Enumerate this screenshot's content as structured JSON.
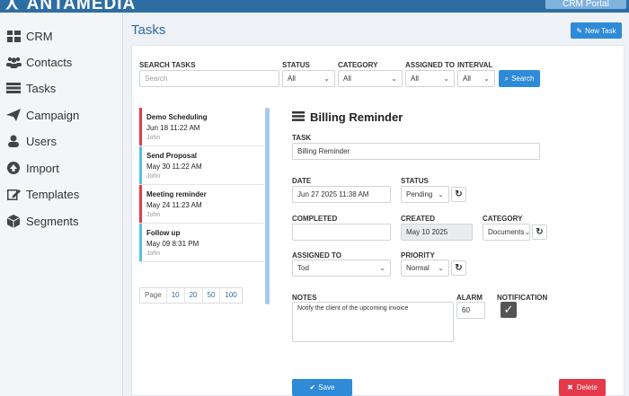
{
  "header": {
    "brand": "ANTAMEDIA",
    "portal_button": "CRM Portal"
  },
  "sidebar": {
    "items": [
      {
        "label": "CRM",
        "icon": "grid-icon"
      },
      {
        "label": "Contacts",
        "icon": "users-group-icon"
      },
      {
        "label": "Tasks",
        "icon": "list-icon"
      },
      {
        "label": "Campaign",
        "icon": "paper-plane-icon"
      },
      {
        "label": "Users",
        "icon": "user-icon"
      },
      {
        "label": "Import",
        "icon": "upload-circle-icon"
      },
      {
        "label": "Templates",
        "icon": "edit-icon"
      },
      {
        "label": "Segments",
        "icon": "cube-icon"
      }
    ]
  },
  "page": {
    "title": "Tasks",
    "new_task_button": "New Task"
  },
  "filters": {
    "search_label": "SEARCH TASKS",
    "search_placeholder": "Search",
    "status_label": "STATUS",
    "status_value": "All",
    "category_label": "CATEGORY",
    "category_value": "All",
    "assigned_label": "ASSIGNED TO",
    "assigned_value": "All",
    "interval_label": "INTERVAL",
    "interval_value": "All",
    "search_button": "Search"
  },
  "tasks": [
    {
      "title": "Demo Scheduling",
      "date": "Jun 18 11:22 AM",
      "user": "John",
      "color": "#e5384a"
    },
    {
      "title": "Send Proposal",
      "date": "May 30 11:22 AM",
      "user": "John",
      "color": "#5bc0de"
    },
    {
      "title": "Meeting reminder",
      "date": "May 24 11:23 AM",
      "user": "John",
      "color": "#e5384a"
    },
    {
      "title": "Follow up",
      "date": "May 09 8:31 PM",
      "user": "John",
      "color": "#5bc0de"
    }
  ],
  "pager": {
    "label": "Page",
    "sizes": [
      "10",
      "20",
      "50",
      "100"
    ]
  },
  "detail": {
    "title": "Billing Reminder",
    "task_label": "TASK",
    "task_value": "Billing Reminder",
    "date_label": "DATE",
    "date_value": "Jun 27 2025 11:38 AM",
    "status_label": "STATUS",
    "status_value": "Pending",
    "completed_label": "COMPLETED",
    "completed_value": "",
    "created_label": "CREATED",
    "created_value": "May 10 2025",
    "category_label": "CATEGORY",
    "category_value": "Documents",
    "assigned_label": "ASSIGNED TO",
    "assigned_value": "Tod",
    "priority_label": "PRIORITY",
    "priority_value": "Normal",
    "notes_label": "NOTES",
    "notes_value": "Notify the client of the upcoming invoice",
    "alarm_label": "ALARM",
    "alarm_value": "60",
    "notification_label": "NOTIFICATION",
    "notification_checked": true,
    "save_button": "Save",
    "delete_button": "Delete"
  },
  "colors": {
    "primary": "#2f8ad8",
    "danger": "#e5384a",
    "brand_bar": "#2e6da4",
    "info": "#5bc0de"
  }
}
